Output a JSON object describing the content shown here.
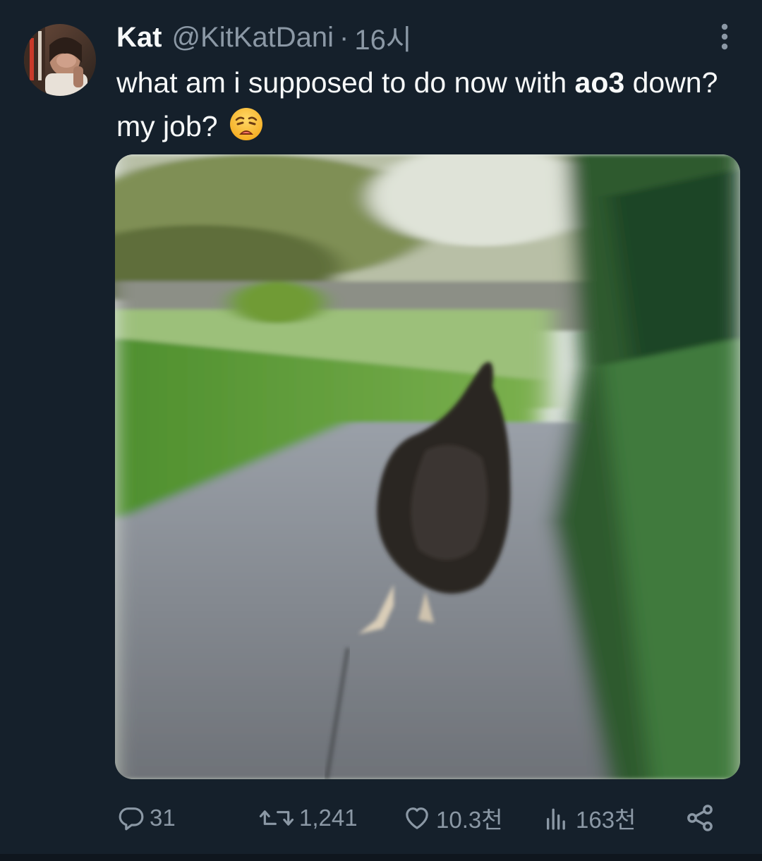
{
  "tweet": {
    "author_name": "Kat",
    "author_handle": "@KitKatDani",
    "separator": "·",
    "time": "16시",
    "text_before": "what am i supposed to do now with ",
    "text_bold": "ao3",
    "text_after": " down? my job?",
    "emoji": "weary-face",
    "media_description": "blurred chicken running down a path"
  },
  "actions": {
    "replies": "31",
    "reposts": "1,241",
    "likes": "10.3천",
    "views": "163천"
  },
  "colors": {
    "background": "#15202b",
    "text": "#f7f9f9",
    "secondary": "#8b98a5"
  },
  "icons": [
    "more-icon",
    "reply-icon",
    "repost-icon",
    "like-icon",
    "views-icon",
    "share-icon"
  ]
}
